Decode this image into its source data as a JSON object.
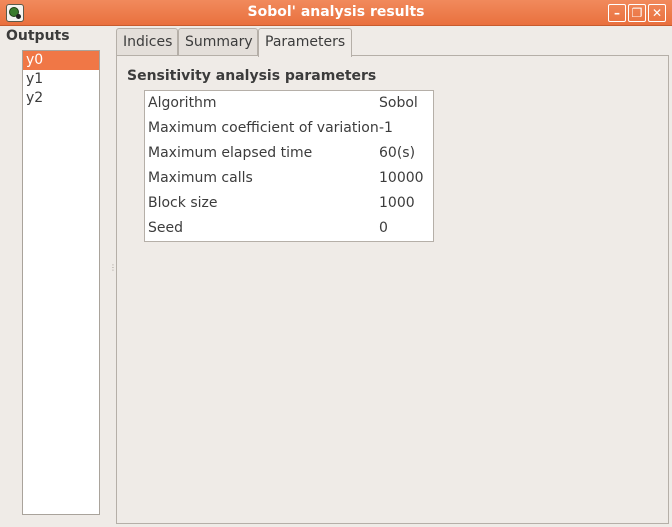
{
  "window": {
    "title": "Sobol' analysis results",
    "buttons": {
      "minimize": "–",
      "maximize": "❐",
      "close": "✕"
    }
  },
  "outputs": {
    "label": "Outputs",
    "items": [
      "y0",
      "y1",
      "y2"
    ],
    "selected": "y0"
  },
  "tabs": [
    {
      "label": "Indices",
      "active": false
    },
    {
      "label": "Summary",
      "active": false
    },
    {
      "label": "Parameters",
      "active": true
    }
  ],
  "parameters": {
    "section_title": "Sensitivity analysis parameters",
    "rows": [
      {
        "key": "Algorithm",
        "value": "Sobol"
      },
      {
        "key": "Maximum coefficient of variation",
        "value": "-1"
      },
      {
        "key": "Maximum elapsed time",
        "value": "60(s)"
      },
      {
        "key": "Maximum calls",
        "value": "10000"
      },
      {
        "key": "Block size",
        "value": "1000"
      },
      {
        "key": "Seed",
        "value": "0"
      }
    ]
  },
  "colors": {
    "titlebar": "#e9703e",
    "selection": "#f07746",
    "background": "#efebe7"
  }
}
